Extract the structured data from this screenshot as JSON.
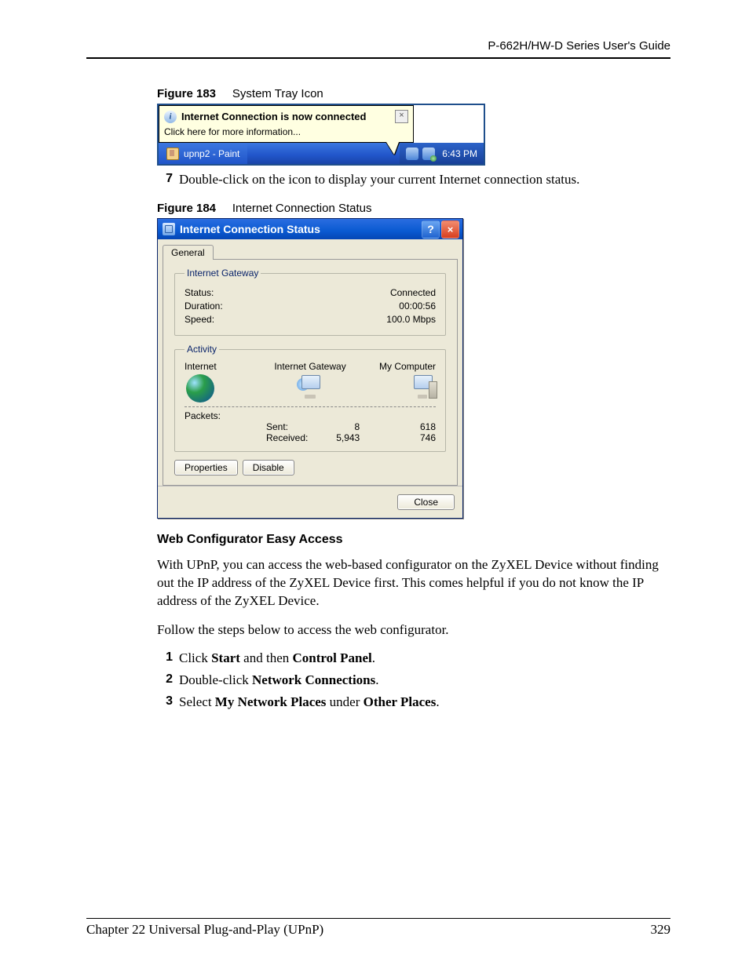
{
  "header": {
    "doc_title": "P-662H/HW-D Series User's Guide"
  },
  "fig183": {
    "caption_label": "Figure 183",
    "caption_text": "System Tray Icon",
    "tooltip_title": "Internet Connection is now connected",
    "tooltip_sub": "Click here for more information...",
    "tooltip_close": "×",
    "taskbar_item": "upnp2 - Paint",
    "tray_time": "6:43 PM"
  },
  "step7": {
    "num": "7",
    "text": "Double-click on the icon to display your current Internet connection status."
  },
  "fig184": {
    "caption_label": "Figure 184",
    "caption_text": "Internet Connection Status",
    "title": "Internet Connection Status",
    "help": "?",
    "close": "×",
    "tab": "General",
    "grp1": {
      "legend": "Internet Gateway",
      "status_k": "Status:",
      "status_v": "Connected",
      "duration_k": "Duration:",
      "duration_v": "00:00:56",
      "speed_k": "Speed:",
      "speed_v": "100.0 Mbps"
    },
    "grp2": {
      "legend": "Activity",
      "col1": "Internet",
      "col2": "Internet Gateway",
      "col3": "My Computer",
      "packets": "Packets:",
      "sent_k": "Sent:",
      "sent_gw": "8",
      "sent_pc": "618",
      "recv_k": "Received:",
      "recv_gw": "5,943",
      "recv_pc": "746"
    },
    "btn_properties": "Properties",
    "btn_disable": "Disable",
    "btn_close": "Close"
  },
  "body": {
    "section_head": "Web Configurator Easy Access",
    "p1": "With UPnP, you can access the web-based configurator on the ZyXEL Device without finding out the IP address of the ZyXEL Device first. This comes helpful if you do not know the IP address of the ZyXEL Device.",
    "p2": "Follow the steps below to access the web configurator.",
    "steps": [
      {
        "n": "1",
        "pre": "Click ",
        "b1": "Start",
        "mid1": " and then ",
        "b2": "Control Panel",
        "post": "."
      },
      {
        "n": "2",
        "pre": "Double-click ",
        "b1": "Network Connections",
        "mid1": "",
        "b2": "",
        "post": "."
      },
      {
        "n": "3",
        "pre": "Select ",
        "b1": "My Network Places",
        "mid1": " under ",
        "b2": "Other Places",
        "post": "."
      }
    ]
  },
  "footer": {
    "chapter": "Chapter 22 Universal Plug-and-Play (UPnP)",
    "page": "329"
  }
}
